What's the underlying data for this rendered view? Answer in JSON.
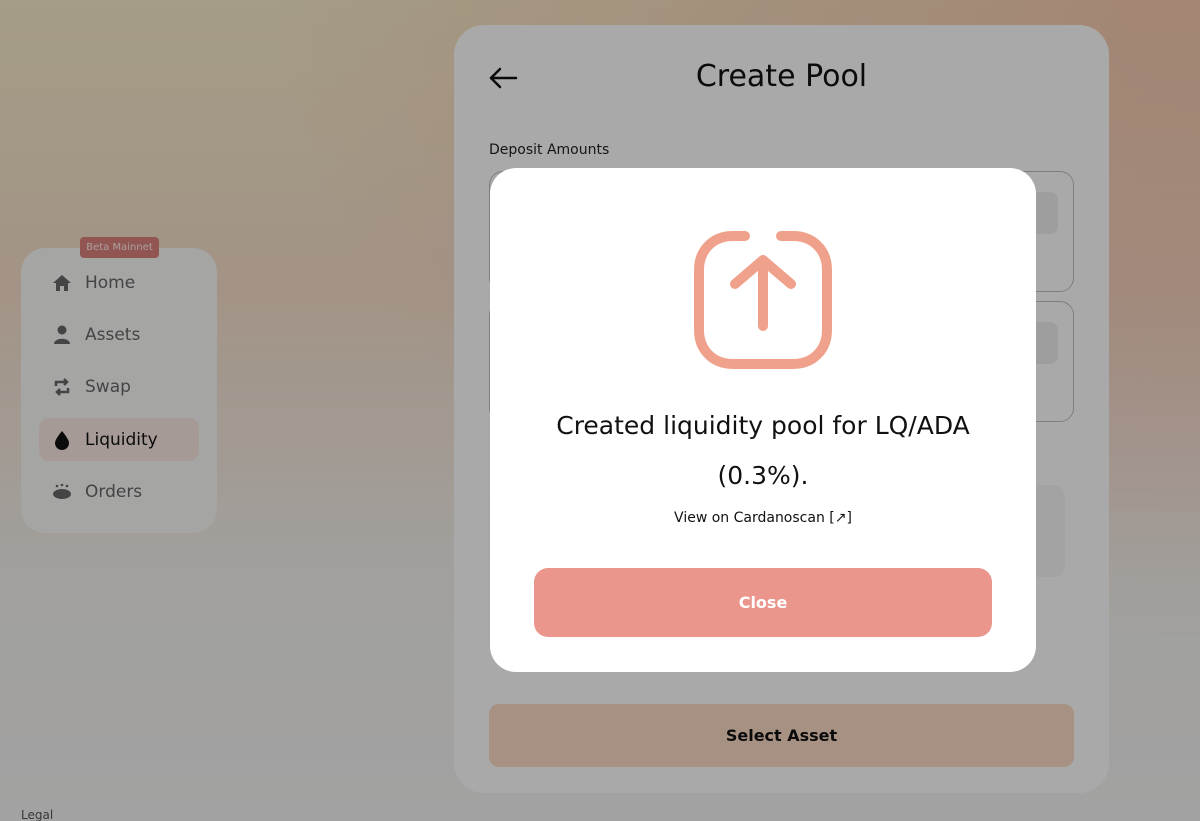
{
  "sidebar": {
    "badge": "Beta Mainnet",
    "items": [
      {
        "label": "Home",
        "icon": "home-icon"
      },
      {
        "label": "Assets",
        "icon": "user-icon"
      },
      {
        "label": "Swap",
        "icon": "swap-icon"
      },
      {
        "label": "Liquidity",
        "icon": "droplet-icon",
        "active": true
      },
      {
        "label": "Orders",
        "icon": "orders-icon"
      }
    ],
    "legal": "Legal"
  },
  "card": {
    "title": "Create Pool",
    "deposit_label": "Deposit Amounts",
    "select_button": "Select Asset"
  },
  "modal": {
    "icon": "upload-icon",
    "message": "Created liquidity pool for LQ/ADA (0.3%).",
    "link": "View on Cardanoscan [↗]",
    "close_button": "Close"
  },
  "colors": {
    "accent": "#ea968c",
    "badge": "#d97f7b",
    "icon_stroke": "#f0a18b",
    "select_button": "#f9d9c3"
  }
}
